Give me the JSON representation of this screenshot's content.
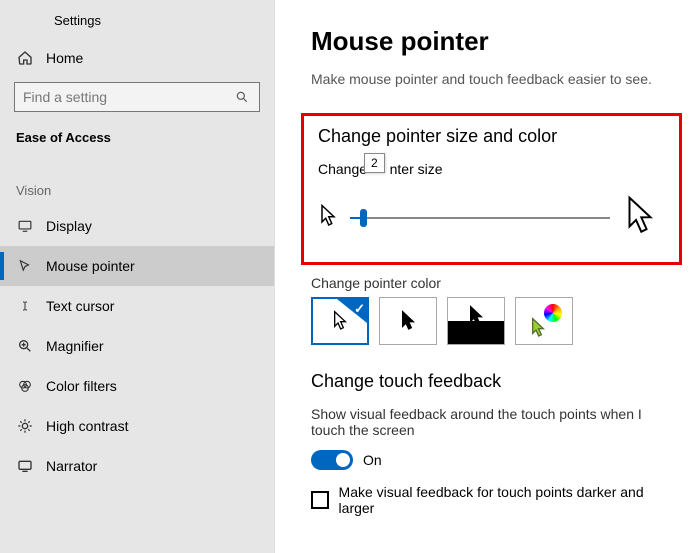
{
  "app": {
    "title": "Settings"
  },
  "home": {
    "label": "Home"
  },
  "search": {
    "placeholder": "Find a setting"
  },
  "category": {
    "label": "Ease of Access"
  },
  "section": {
    "label": "Vision"
  },
  "nav": {
    "items": [
      {
        "label": "Display"
      },
      {
        "label": "Mouse pointer"
      },
      {
        "label": "Text cursor"
      },
      {
        "label": "Magnifier"
      },
      {
        "label": "Color filters"
      },
      {
        "label": "High contrast"
      },
      {
        "label": "Narrator"
      }
    ]
  },
  "page": {
    "title": "Mouse pointer",
    "subtitle": "Make mouse pointer and touch feedback easier to see."
  },
  "pointer_size": {
    "heading": "Change pointer size and color",
    "label_part1": "Change",
    "label_part2": "nter size",
    "value": "2"
  },
  "pointer_color": {
    "label": "Change pointer color"
  },
  "touch": {
    "heading": "Change touch feedback",
    "text": "Show visual feedback around the touch points when I touch the screen",
    "toggle_label": "On",
    "checkbox_label": "Make visual feedback for touch points darker and larger"
  }
}
